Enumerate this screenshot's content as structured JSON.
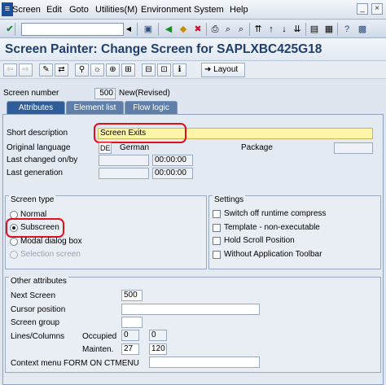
{
  "menu": {
    "items": [
      "Screen",
      "Edit",
      "Goto",
      "Utilities(M)",
      "Environment",
      "System",
      "Help"
    ]
  },
  "toolbar": {
    "command_value": "",
    "icons": [
      "check-icon",
      "dropdown-icon",
      "save-icon",
      "back-icon",
      "exit-icon",
      "cancel-icon",
      "print-icon",
      "find-icon",
      "find-next-icon",
      "first-page-icon",
      "prev-page-icon",
      "next-page-icon",
      "last-page-icon",
      "new-session-icon",
      "shortcut-icon",
      "help-icon",
      "customize-icon"
    ]
  },
  "title": "Screen Painter: Change Screen for SAPLXBC425G18",
  "app_toolbar": {
    "layout_label": "Layout"
  },
  "screen": {
    "number_label": "Screen number",
    "number_value": "500",
    "status": "New(Revised)"
  },
  "tabs": [
    {
      "label": "Attributes",
      "active": true
    },
    {
      "label": "Element list",
      "active": false
    },
    {
      "label": "Flow logic",
      "active": false
    }
  ],
  "attributes": {
    "short_desc_label": "Short description",
    "short_desc_value": "Screen Exits",
    "orig_lang_label": "Original language",
    "orig_lang_code": "DE",
    "orig_lang_name": "German",
    "package_label": "Package",
    "package_value": "",
    "last_changed_label": "Last changed on/by",
    "last_changed_time": "00:00:00",
    "last_gen_label": "Last generation",
    "last_gen_time": "00:00:00"
  },
  "screen_type": {
    "title": "Screen type",
    "options": [
      {
        "label": "Normal",
        "selected": false,
        "disabled": false
      },
      {
        "label": "Subscreen",
        "selected": true,
        "disabled": false
      },
      {
        "label": "Modal dialog box",
        "selected": false,
        "disabled": false
      },
      {
        "label": "Selection screen",
        "selected": false,
        "disabled": true
      }
    ]
  },
  "settings": {
    "title": "Settings",
    "options": [
      {
        "label": "Switch off runtime compress",
        "checked": false
      },
      {
        "label": "Template - non-executable",
        "checked": false
      },
      {
        "label": "Hold Scroll Position",
        "checked": false
      },
      {
        "label": "Without Application Toolbar",
        "checked": false
      }
    ]
  },
  "other": {
    "title": "Other attributes",
    "next_screen_label": "Next Screen",
    "next_screen_value": "500",
    "cursor_label": "Cursor position",
    "cursor_value": "",
    "group_label": "Screen group",
    "group_value": "",
    "lines_cols_label": "Lines/Columns",
    "occupied_label": "Occupied",
    "occupied_lines": "0",
    "occupied_cols": "0",
    "mainten_label": "Mainten.",
    "mainten_lines": "27",
    "mainten_cols": "120",
    "context_label": "Context menu FORM ON CTMENU",
    "context_value": ""
  },
  "colors": {
    "title": "#1f3f6e",
    "tab_active": "#2e5d9a",
    "highlight_ring": "#e0101e",
    "required_field": "#fff5a8"
  }
}
